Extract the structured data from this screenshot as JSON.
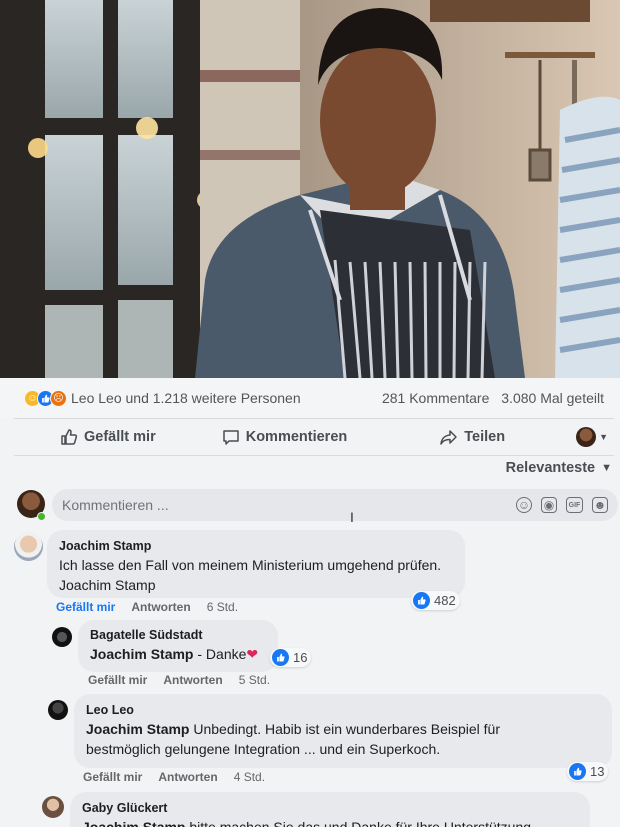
{
  "post": {
    "reactions_text": "Leo Leo und 1.218 weitere Personen",
    "comments_count": "281 Kommentare",
    "shares_count": "3.080 Mal geteilt",
    "reaction_types": [
      "care",
      "like",
      "angry"
    ]
  },
  "actions": {
    "like": "Gefällt mir",
    "comment": "Kommentieren",
    "share": "Teilen"
  },
  "sort": {
    "label": "Relevanteste"
  },
  "composer": {
    "placeholder": "Kommentieren ..."
  },
  "comments": [
    {
      "author": "Joachim Stamp",
      "line1": "Ich lasse den Fall von meinem Ministerium umgehend prüfen.",
      "line2": "Joachim Stamp",
      "like_label": "Gefällt mir",
      "reply_label": "Antworten",
      "time": "6 Std.",
      "likes": "482"
    },
    {
      "author": "Bagatelle Südstadt",
      "mention": "Joachim Stamp",
      "text": " - Danke",
      "heart": "❤",
      "like_label": "Gefällt mir",
      "reply_label": "Antworten",
      "time": "5 Std.",
      "likes": "16"
    },
    {
      "author": "Leo Leo",
      "mention": "Joachim Stamp",
      "text_line1": " Unbedingt. Habib ist ein wunderbares Beispiel für",
      "text_line2": "bestmöglich gelungene Integration ... und ein Superkoch.",
      "like_label": "Gefällt mir",
      "reply_label": "Antworten",
      "time": "4 Std.",
      "likes": "13"
    },
    {
      "author": "Gaby Glückert",
      "mention": "Joachim Stamp",
      "text": " bitte machen Sie das und Danke für Ihre Unterstützung"
    }
  ],
  "colors": {
    "accent": "#1877f2",
    "bubble": "#e8e9ec",
    "muted": "#65676b"
  }
}
